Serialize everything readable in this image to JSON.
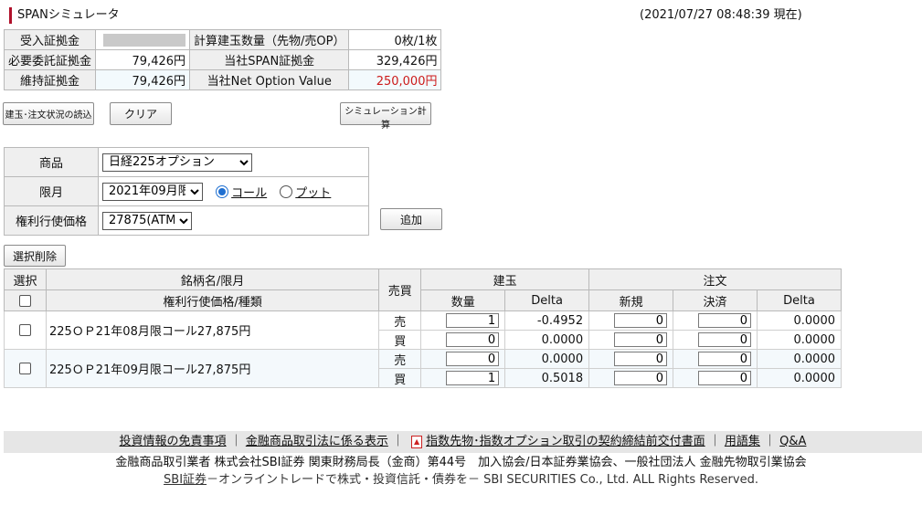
{
  "header": {
    "title": "SPANシミュレータ",
    "timestamp": "(2021/07/27 08:48:39 現在)"
  },
  "summary": {
    "rows": [
      {
        "l1": "受入証拠金",
        "v1": "",
        "l2": "計算建玉数量（先物/売OP）",
        "v2": "0枚/1枚"
      },
      {
        "l1": "必要委託証拠金",
        "v1": "79,426円",
        "l2": "当社SPAN証拠金",
        "v2": "329,426円"
      },
      {
        "l1": "維持証拠金",
        "v1": "79,426円",
        "l2": "当社Net Option Value",
        "v2": "250,000円"
      }
    ]
  },
  "buttons": {
    "load": "建玉･注文状況の読込",
    "clear": "クリア",
    "calc": "シミュレーション計算",
    "add": "追加",
    "delete": "選択削除"
  },
  "selector": {
    "product_label": "商品",
    "product_value": "日経225オプション",
    "month_label": "限月",
    "month_value": "2021年09月限",
    "call_label": "コール",
    "put_label": "プット",
    "strike_label": "権利行使価格",
    "strike_value": "27875(ATM)"
  },
  "grid": {
    "h_select": "選択",
    "h_name1": "銘柄名/限月",
    "h_name2": "権利行使価格/種類",
    "h_side": "売買",
    "h_position": "建玉",
    "h_qty": "数量",
    "h_delta": "Delta",
    "h_order": "注文",
    "h_new": "新規",
    "h_close": "決済",
    "h_delta2": "Delta",
    "rows": [
      {
        "name": "225ＯＰ21年08月限コール27,875円",
        "sell": {
          "side": "売",
          "qty": "1",
          "delta": "-0.4952",
          "new": "0",
          "close": "0",
          "odelta": "0.0000"
        },
        "buy": {
          "side": "買",
          "qty": "0",
          "delta": "0.0000",
          "new": "0",
          "close": "0",
          "odelta": "0.0000"
        }
      },
      {
        "name": "225ＯＰ21年09月限コール27,875円",
        "sell": {
          "side": "売",
          "qty": "0",
          "delta": "0.0000",
          "new": "0",
          "close": "0",
          "odelta": "0.0000"
        },
        "buy": {
          "side": "買",
          "qty": "1",
          "delta": "0.5018",
          "new": "0",
          "close": "0",
          "odelta": "0.0000"
        }
      }
    ]
  },
  "footer": {
    "link1": "投資情報の免責事項",
    "link2": "金融商品取引法に係る表示",
    "link3": "指数先物･指数オプション取引の契約締結前交付書面",
    "link4": "用語集",
    "link5": "Q&A",
    "line2": "金融商品取引業者 株式会社SBI証券 関東財務局長（金商）第44号　加入協会/日本証券業協会、一般社団法人 金融先物取引業協会",
    "sbi": "SBI証券",
    "line3": "－オンライントレードで株式・投資信託・債券を－ SBI SECURITIES Co., Ltd. ALL Rights Reserved."
  }
}
